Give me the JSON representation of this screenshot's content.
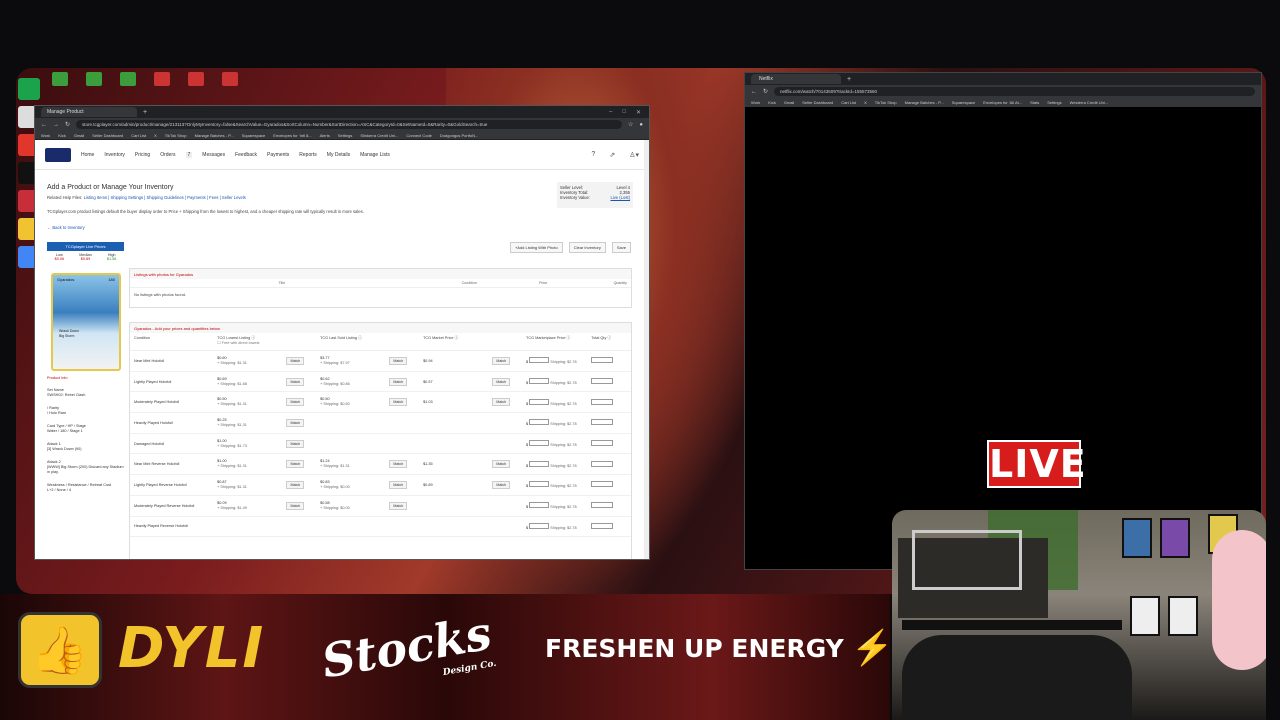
{
  "left_browser": {
    "tab_title": "Manage Product",
    "url": "store.tcgplayer.com/admin/product/manage/213113?OnlyMyInventory=false&SearchValue=Gyarados&SortColumn=Number&SortDirection=ASC&CategoryId=0&SetNameId=0&Rarity=0&GoldSearch=true",
    "bookmarks": [
      "Work",
      "Kick",
      "Gmail",
      "Seller Dashboard",
      "Cart List",
      "X",
      "TikTok Shop",
      "Manage Batches - P...",
      "Squarespace",
      "Envelopes for 'Intl 8...",
      "Alerts",
      "Settings",
      "Slinkerra Credit Uni...",
      "Connect Code",
      "Dodgongos PortfoN..."
    ]
  },
  "nav": {
    "items": [
      "Home",
      "Inventory",
      "Pricing",
      "Orders",
      "Messages",
      "Feedback",
      "Payments",
      "Reports",
      "My Details",
      "Manage Lists"
    ],
    "orders_badge": "7"
  },
  "page": {
    "title": "Add a Product or Manage Your Inventory",
    "help_prefix": "Related Help Files:",
    "help_links": "Listing Items | Shipping Settings | Shipping Guidelines | Payments | Fees | Seller Levels",
    "note": "TCGplayer.com product listings default the buyer display order to Price + Shipping from the lowest to highest, and a cheaper shipping rate will typically result in more sales.",
    "back": "← Back to Inventory",
    "seller_level_label": "Seller Level:",
    "seller_level": "Level 4",
    "inventory_total_label": "Inventory Total:",
    "inventory_total": "2,355",
    "inventory_value_label": "Inventory Value:",
    "inventory_value": "Live (Lost)",
    "buttons": [
      "+Add Listing With Photo",
      "Clear Inventory",
      "Save"
    ]
  },
  "live_prices": {
    "header": "TCGplayer Live Prices",
    "low_label": "Low",
    "low": "$0.06",
    "median_label": "Median",
    "median": "$0.89",
    "high_label": "High",
    "high": "$1.56"
  },
  "card": {
    "name": "Gyarados",
    "hp": "180",
    "attack1": "Wrack Down",
    "attack2": "Big Storm"
  },
  "product_info": {
    "header": "Product Info",
    "set_name_label": "Set Name",
    "set_name": "SWSH02: Rebel Clash",
    "rarity_label": "/ Rarity",
    "rarity": "/ Holo Rare",
    "cardtype_label": "Card Type / HP / Stage",
    "cardtype": "Water / 180 / Stage 1",
    "attack1_label": "Attack 1",
    "attack1": "[3] Wrack Down (90)",
    "attack2_label": "Attack 2",
    "attack2": "[WWW] Big Storm (200) Discard any Stadium in play.",
    "weakness_label": "Weakness / Resistance / Retreat Cost",
    "weakness": "L+2 / None / 4"
  },
  "photos_panel": {
    "header": "Listings with photos for Gyarados",
    "cols": [
      "Title",
      "Condition",
      "Price",
      "Quantity"
    ],
    "empty": "No listings with photos found."
  },
  "listing_panel": {
    "header": "Gyarados - Add your prices and quantities below",
    "cols": [
      "Condition",
      "TCG Lowest Listing",
      "TCG Last Sold Listing",
      "TCG Market Price",
      "TCG Marketplace Price",
      "Total Qty"
    ],
    "free_shipping": "Free with direct lowest",
    "match_label": "Match",
    "rows": [
      {
        "cond": "Near Mint Holofoil",
        "low": "$0.60",
        "low_ship": "+ Shipping: $1.31",
        "last": "$3.77",
        "last_ship": "+ Shipping: $7.97",
        "market": "$0.94",
        "mp_ship": "Shipping: $2.78"
      },
      {
        "cond": "Lightly Played Holofoil",
        "low": "$0.69",
        "low_ship": "+ Shipping: $1.68",
        "last": "$0.62",
        "last_ship": "+ Shipping: $0.86",
        "market": "$0.57",
        "mp_ship": "Shipping: $2.78"
      },
      {
        "cond": "Moderately Played Holofoil",
        "low": "$0.50",
        "low_ship": "+ Shipping: $1.31",
        "last": "$0.50",
        "last_ship": "+ Shipping: $0.50",
        "market": "$1.03",
        "mp_ship": "Shipping: $2.78"
      },
      {
        "cond": "Heavily Played Holofoil",
        "low": "$0.25",
        "low_ship": "+ Shipping: $1.31",
        "last": "",
        "last_ship": "",
        "market": "",
        "mp_ship": "Shipping: $2.78"
      },
      {
        "cond": "Damaged Holofoil",
        "low": "$1.00",
        "low_ship": "+ Shipping: $1.73",
        "last": "",
        "last_ship": "",
        "market": "",
        "mp_ship": "Shipping: $2.78"
      },
      {
        "cond": "Near Mint Reverse Holofoil",
        "low": "$1.00",
        "low_ship": "+ Shipping: $1.31",
        "last": "$1.24",
        "last_ship": "+ Shipping: $1.31",
        "market": "$1.35",
        "mp_ship": "Shipping: $2.78"
      },
      {
        "cond": "Lightly Played Reverse Holofoil",
        "low": "$0.87",
        "low_ship": "+ Shipping: $1.31",
        "last": "$0.83",
        "last_ship": "+ Shipping: $0.00",
        "market": "$0.89",
        "mp_ship": "Shipping: $2.78"
      },
      {
        "cond": "Moderately Played Reverse Holofoil",
        "low": "$0.09",
        "low_ship": "+ Shipping: $1.49",
        "last": "$0.58",
        "last_ship": "+ Shipping: $0.00",
        "market": "",
        "mp_ship": "Shipping: $2.78"
      },
      {
        "cond": "Heavily Played Reverse Holofoil",
        "low": "",
        "low_ship": "",
        "last": "",
        "last_ship": "",
        "market": "",
        "mp_ship": "Shipping: $2.78"
      }
    ]
  },
  "right_browser": {
    "tab_title": "Netflix",
    "url": "netflix.com/watch/70143609?trackId=155573560",
    "bookmarks": [
      "Work",
      "Kick",
      "Gmail",
      "Seller Dashboard",
      "Cart List",
      "X",
      "TikTok Shop",
      "Manage Batches - P...",
      "Squarespace",
      "Envelopes for 'All At...",
      "Stats",
      "Settings",
      "Westerra Credit Uni..."
    ]
  },
  "overlay": {
    "live": "LIVE",
    "sponsor1": "DYLI",
    "sponsor2": "Stocks",
    "sponsor2_sub": "Design Co.",
    "sponsor3": "FRESHEN UP ENERGY"
  }
}
